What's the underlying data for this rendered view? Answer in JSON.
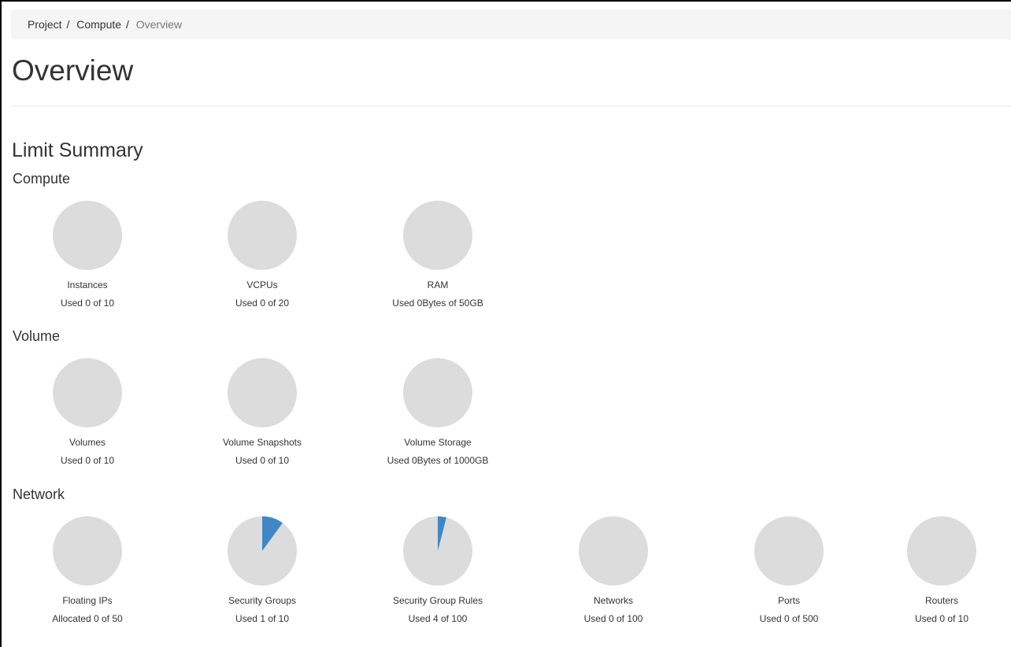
{
  "breadcrumb": {
    "items": [
      "Project",
      "Compute"
    ],
    "separator": "/",
    "current": "Overview"
  },
  "page_title": "Overview",
  "section_title": "Limit Summary",
  "colors": {
    "pie_empty": "#dcdcdc",
    "pie_used": "#3f87c6"
  },
  "groups": [
    {
      "title": "Compute",
      "charts": [
        {
          "label": "Instances",
          "usage_text": "Used 0 of 10",
          "used": 0,
          "limit": 10
        },
        {
          "label": "VCPUs",
          "usage_text": "Used 0 of 20",
          "used": 0,
          "limit": 20
        },
        {
          "label": "RAM",
          "usage_text": "Used 0Bytes of 50GB",
          "used": 0,
          "limit": 50
        }
      ]
    },
    {
      "title": "Volume",
      "charts": [
        {
          "label": "Volumes",
          "usage_text": "Used 0 of 10",
          "used": 0,
          "limit": 10
        },
        {
          "label": "Volume Snapshots",
          "usage_text": "Used 0 of 10",
          "used": 0,
          "limit": 10
        },
        {
          "label": "Volume Storage",
          "usage_text": "Used 0Bytes of 1000GB",
          "used": 0,
          "limit": 1000
        }
      ]
    },
    {
      "title": "Network",
      "charts": [
        {
          "label": "Floating IPs",
          "usage_text": "Allocated 0 of 50",
          "used": 0,
          "limit": 50
        },
        {
          "label": "Security Groups",
          "usage_text": "Used 1 of 10",
          "used": 1,
          "limit": 10
        },
        {
          "label": "Security Group Rules",
          "usage_text": "Used 4 of 100",
          "used": 4,
          "limit": 100
        },
        {
          "label": "Networks",
          "usage_text": "Used 0 of 100",
          "used": 0,
          "limit": 100
        },
        {
          "label": "Ports",
          "usage_text": "Used 0 of 500",
          "used": 0,
          "limit": 500
        },
        {
          "label": "Routers",
          "usage_text": "Used 0 of 10",
          "used": 0,
          "limit": 10
        }
      ]
    }
  ]
}
